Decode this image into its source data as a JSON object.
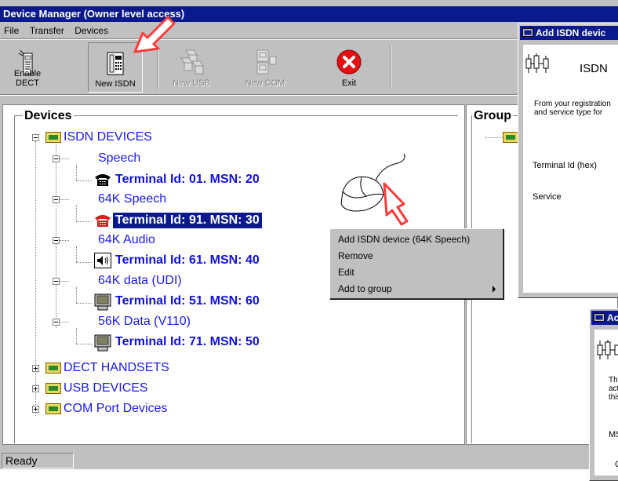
{
  "window": {
    "title": "Device Manager (Owner level access)"
  },
  "menu": [
    "File",
    "Transfer",
    "Devices"
  ],
  "toolbar": {
    "enable_dect": "Enable DECT",
    "new_isdn": "New ISDN",
    "new_usb": "New USB",
    "new_com": "New COM",
    "exit": "Exit"
  },
  "devices": {
    "title": "Devices",
    "isdn_root": "ISDN DEVICES",
    "groups": [
      {
        "label": "Speech",
        "terminal": "Terminal Id: 01.  MSN: 20"
      },
      {
        "label": "64K Speech",
        "terminal": "Terminal Id: 91.  MSN: 30"
      },
      {
        "label": "64K Audio",
        "terminal": "Terminal Id: 61.  MSN: 40"
      },
      {
        "label": "64K data (UDI)",
        "terminal": "Terminal Id: 51.  MSN: 60"
      },
      {
        "label": "56K Data (V110)",
        "terminal": "Terminal Id: 71.  MSN: 50"
      }
    ],
    "dect": "DECT HANDSETS",
    "usb": "USB DEVICES",
    "com": "COM Port Devices"
  },
  "groups_panel": {
    "title": "Group"
  },
  "context_menu": {
    "add": "Add ISDN device (64K Speech)",
    "remove": "Remove",
    "edit": "Edit",
    "add_to_group": "Add to group"
  },
  "status": {
    "text": "Ready"
  },
  "dialog1": {
    "title": "Add ISDN devic",
    "heading": "ISDN",
    "desc_line1": "From your registration",
    "desc_line2": "and service type for",
    "terminal_label": "Terminal Id (hex)",
    "service_label": "Service"
  },
  "dialog2": {
    "title": "Ac",
    "line1": "Th",
    "line2": "act",
    "line3": "this",
    "ms": "MS",
    "ch": "Ch"
  },
  "colors": {
    "title_bar": "#0a1a8c",
    "link_blue": "#1010e0",
    "arrow": "#ff3b3b"
  }
}
